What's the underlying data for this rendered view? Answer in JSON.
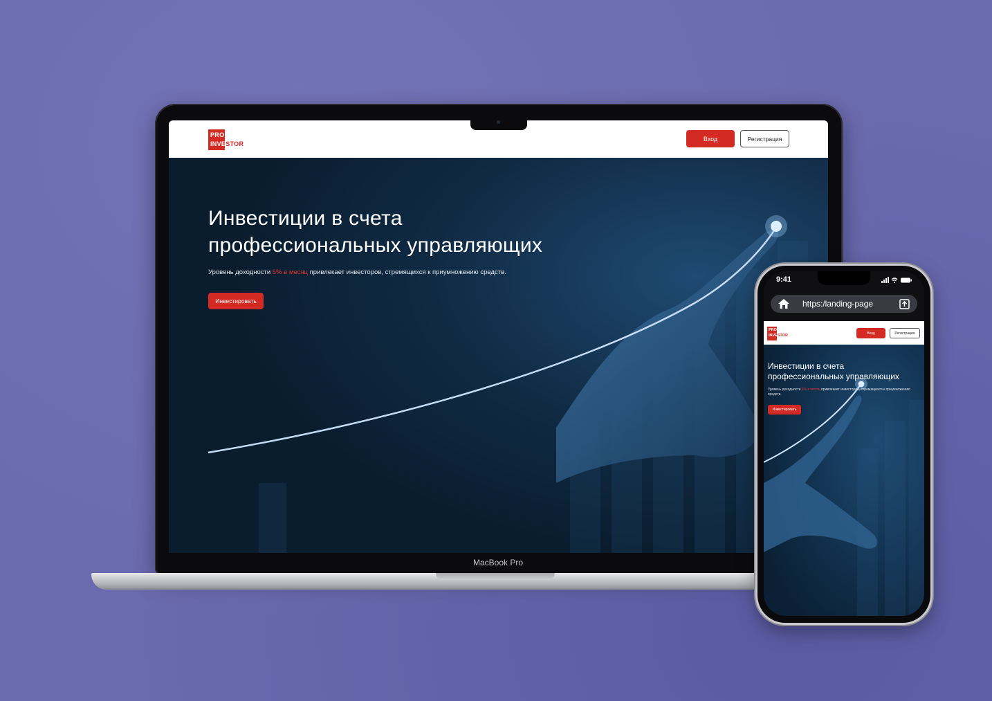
{
  "laptop": {
    "label": "MacBook Pro",
    "site": {
      "logo": {
        "line1": "PRO",
        "line2_a": "INVE",
        "line2_b": "STOR"
      },
      "nav": {
        "login_label": "Вход",
        "register_label": "Регистрация"
      },
      "hero": {
        "title_line1": "Инвестиции в счета",
        "title_line2": "профессиональных управляющих",
        "subtitle_pre": "Уровень доходности ",
        "subtitle_accent": "5% в месяц",
        "subtitle_post": " привлекает инвесторов, стремящихся к приумножению средств.",
        "cta_label": "Инвестировать"
      }
    }
  },
  "phone": {
    "status": {
      "time": "9:41"
    },
    "browser": {
      "url": "https:/landing-page"
    },
    "site": {
      "logo": {
        "line1": "PRO",
        "line2_a": "INVE",
        "line2_b": "STOR"
      },
      "nav": {
        "login_label": "Вход",
        "register_label": "Регистрация"
      },
      "hero": {
        "title_line1": "Инвестиции в счета",
        "title_line2": "профессиональных управляющих",
        "subtitle_pre": "Уровень доходности ",
        "subtitle_accent": "5% в месяц",
        "subtitle_post": " привлекает инвесторов, стремящихся к приумножению средств.",
        "cta_label": "Инвестировать"
      }
    }
  },
  "colors": {
    "accent": "#d32a24",
    "hero_bg": "#0c2236",
    "backdrop": "#6a6aae"
  },
  "icons": [
    "home-icon",
    "share-icon",
    "signal-icon",
    "wifi-icon",
    "battery-icon",
    "camera-icon"
  ]
}
